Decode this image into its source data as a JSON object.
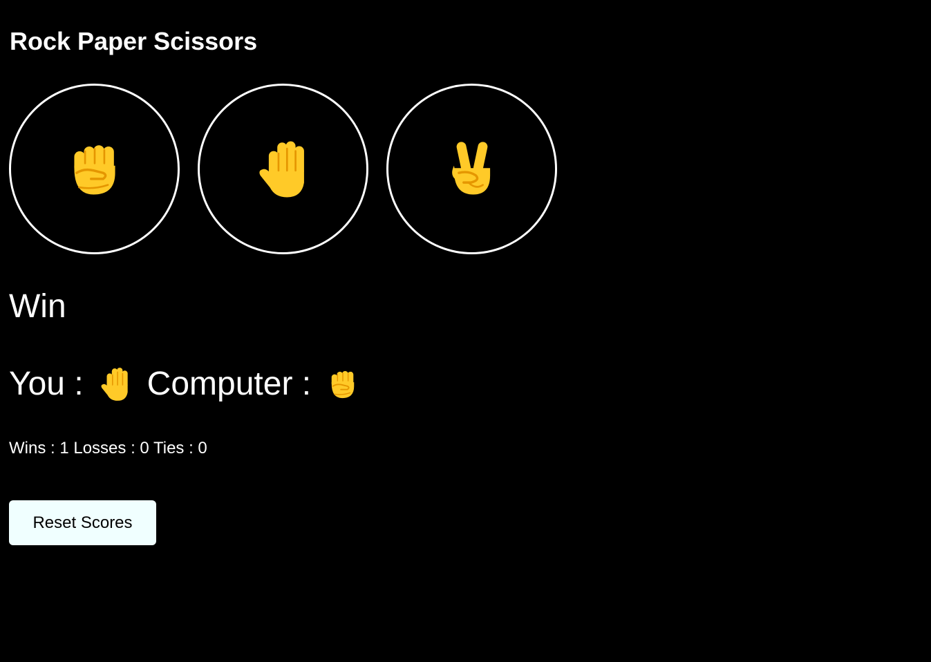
{
  "app": {
    "title": "Rock Paper Scissors"
  },
  "choices": [
    {
      "name": "rock",
      "icon": "raised-fist-icon"
    },
    {
      "name": "paper",
      "icon": "raised-hand-icon"
    },
    {
      "name": "scissors",
      "icon": "victory-hand-icon"
    }
  ],
  "result": {
    "text": "Win"
  },
  "moves": {
    "you_label": "You :",
    "you_icon": "raised-hand-icon",
    "computer_label": "Computer :",
    "computer_icon": "raised-fist-icon"
  },
  "score": {
    "text": "Wins : 1 Losses : 0 Ties : 0",
    "wins": 1,
    "losses": 0,
    "ties": 0
  },
  "reset_button": {
    "label": "Reset Scores"
  },
  "colors": {
    "background": "#000000",
    "text": "#ffffff",
    "emoji_yellow": "#FFCA28",
    "emoji_shade": "#E59600",
    "button_bg": "#F0FFFF"
  }
}
